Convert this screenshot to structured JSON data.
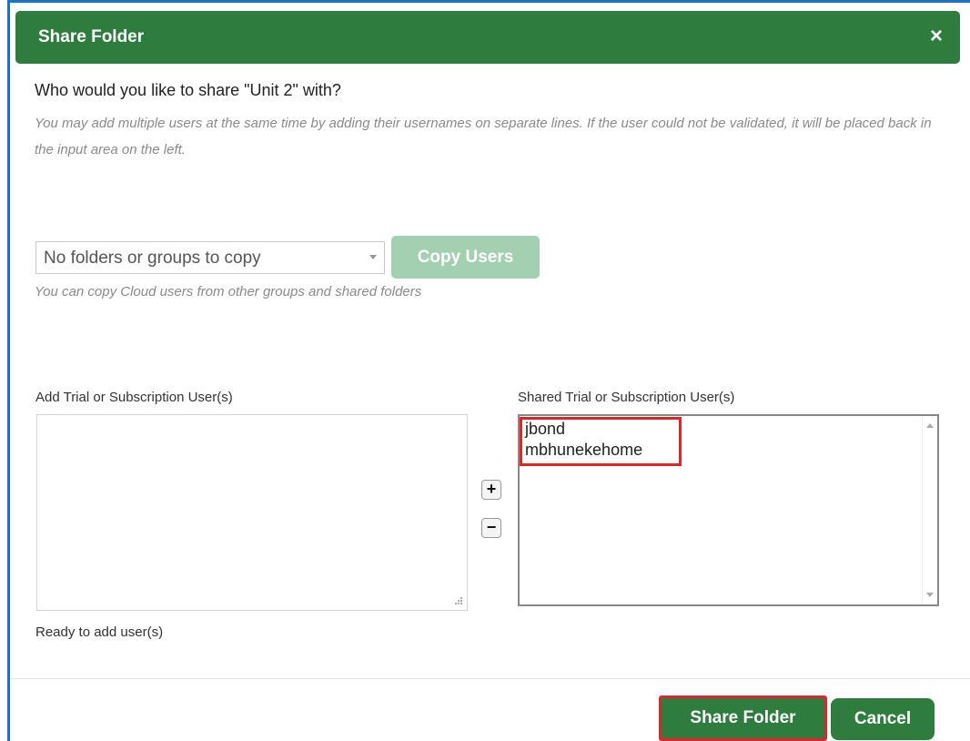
{
  "dialog": {
    "title": "Share Folder",
    "close_icon": "close-icon",
    "question": "Who would you like to share \"Unit 2\" with?",
    "help_text": "You may add multiple users at the same time by adding their usernames on separate lines. If the user could not be validated, it will be placed back in the input area on the left."
  },
  "copy": {
    "select_value": "No folders or groups to copy",
    "button_label": "Copy Users",
    "help_text": "You can copy Cloud users from other groups and shared folders"
  },
  "add_users": {
    "label": "Add Trial or Subscription User(s)",
    "value": "",
    "status": "Ready to add user(s)"
  },
  "transfer": {
    "add_label": "+",
    "remove_label": "−"
  },
  "shared_users": {
    "label": "Shared Trial or Subscription User(s)",
    "items": [
      "jbond",
      "mbhunekehome"
    ]
  },
  "footer": {
    "share_label": "Share Folder",
    "cancel_label": "Cancel"
  },
  "colors": {
    "primary_green": "#2f7d3e",
    "disabled_green": "#a3d0b0",
    "highlight_red": "#e0242a",
    "frame_blue": "#1a73c9"
  }
}
